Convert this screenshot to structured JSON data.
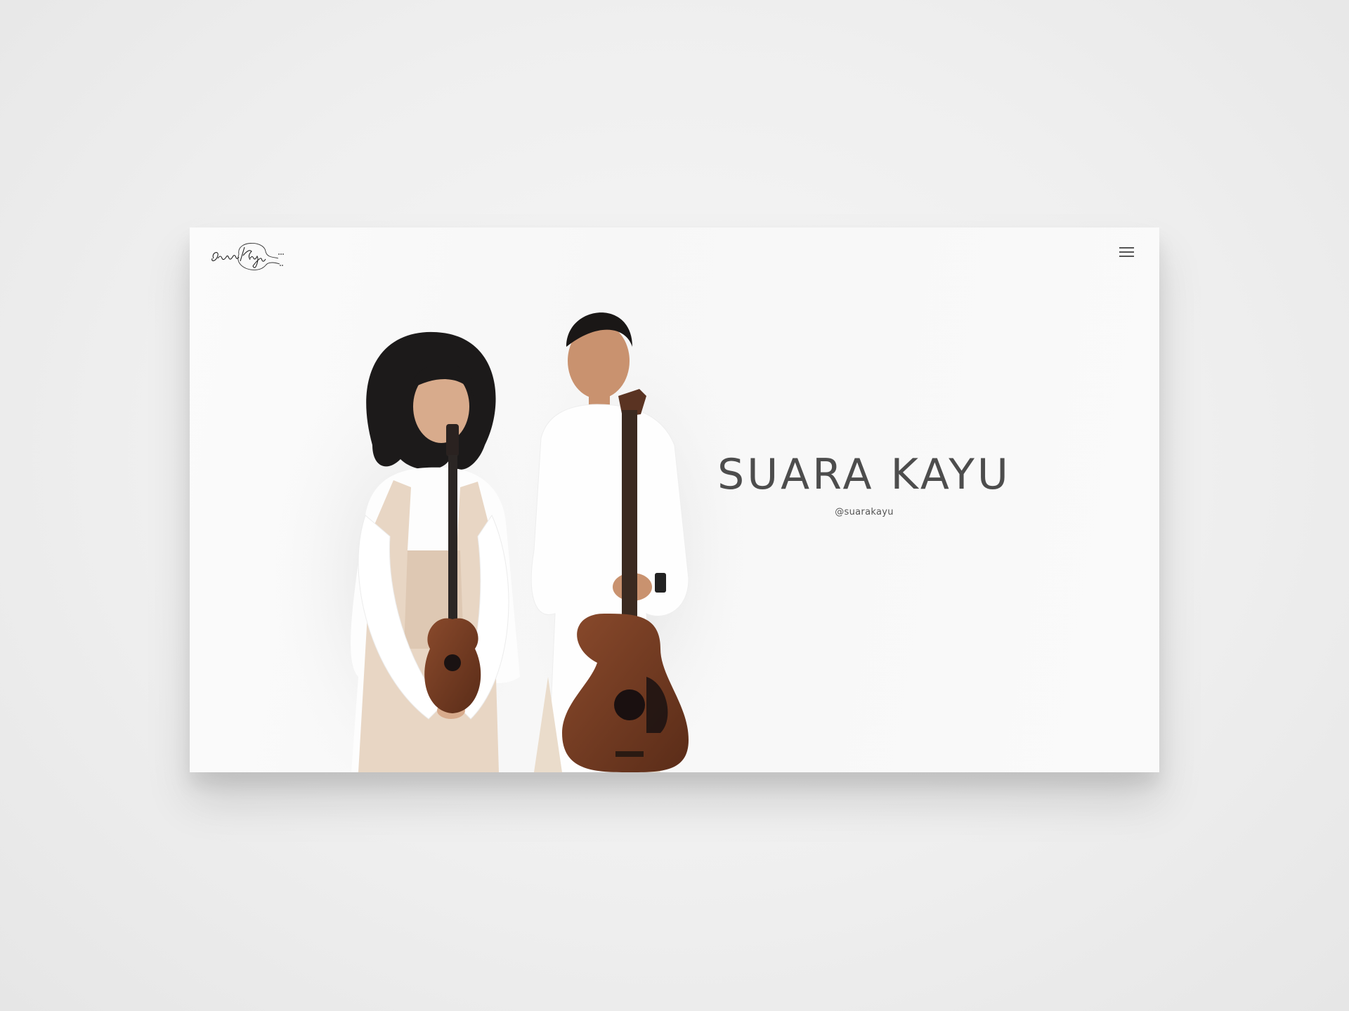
{
  "site": {
    "logo_text": "Suara Kayu",
    "menu_icon": "hamburger-menu-icon"
  },
  "hero": {
    "title": "SUARA KAYU",
    "handle": "@suarakayu"
  },
  "colors": {
    "background": "#efefef",
    "page": "#f9f9f9",
    "title": "#4d4d4d"
  }
}
